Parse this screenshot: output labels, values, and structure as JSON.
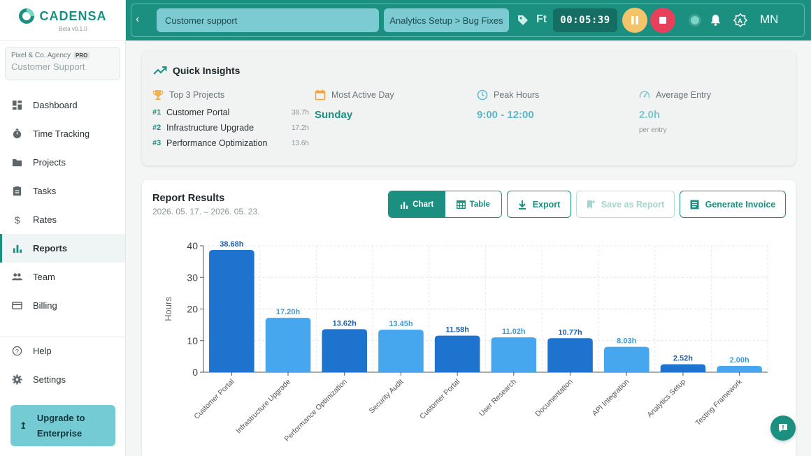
{
  "app": {
    "name": "CADENSA",
    "version": "Beta v0.1.0"
  },
  "org": {
    "name": "Pixel & Co. Agency",
    "plan": "PRO",
    "workspace": "Customer Support"
  },
  "nav": {
    "items": [
      {
        "label": "Dashboard",
        "icon": "dashboard-icon"
      },
      {
        "label": "Time Tracking",
        "icon": "timer-icon"
      },
      {
        "label": "Projects",
        "icon": "folder-icon"
      },
      {
        "label": "Tasks",
        "icon": "clipboard-icon"
      },
      {
        "label": "Rates",
        "icon": "dollar-icon"
      },
      {
        "label": "Reports",
        "icon": "bar-chart-icon",
        "active": true
      },
      {
        "label": "Team",
        "icon": "team-icon"
      },
      {
        "label": "Billing",
        "icon": "card-icon"
      }
    ],
    "bottom": [
      {
        "label": "Help",
        "icon": "help-icon"
      },
      {
        "label": "Settings",
        "icon": "gear-icon"
      }
    ],
    "upgrade_line1": "Upgrade to",
    "upgrade_line2": "Enterprise"
  },
  "topbar": {
    "description_value": "Customer support",
    "project_path": "Analytics Setup > Bug Fixes",
    "tag_abbrev": "Ft",
    "timer": "00:05:39",
    "avatar_initials": "MN"
  },
  "insights": {
    "title": "Quick Insights",
    "top_projects_label": "Top 3 Projects",
    "top_projects": [
      {
        "rank": "#1",
        "name": "Customer Portal",
        "hours": "38.7h"
      },
      {
        "rank": "#2",
        "name": "Infrastructure Upgrade",
        "hours": "17.2h"
      },
      {
        "rank": "#3",
        "name": "Performance Optimization",
        "hours": "13.6h"
      }
    ],
    "most_active_label": "Most Active Day",
    "most_active_value": "Sunday",
    "peak_hours_label": "Peak Hours",
    "peak_hours_value": "9:00 - 12:00",
    "avg_entry_label": "Average Entry",
    "avg_entry_value": "2.0h",
    "avg_entry_note": "per entry"
  },
  "report": {
    "title": "Report Results",
    "date_range": "2026. 05. 17. – 2026. 05. 23.",
    "view_chart": "Chart",
    "view_table": "Table",
    "export": "Export",
    "save_report": "Save as Report",
    "generate_invoice": "Generate Invoice"
  },
  "colors": {
    "primary": "#1b8f80",
    "bar_dark": "#1e73cf",
    "bar_light": "#46a6ee"
  },
  "chart_data": {
    "type": "bar",
    "ylabel": "Hours",
    "ylim": [
      0,
      40
    ],
    "yticks": [
      0,
      10,
      20,
      30,
      40
    ],
    "grid": true,
    "categories": [
      "Customer Portal",
      "Infrastructure Upgrade",
      "Performance Optimization",
      "Security Audit",
      "Customer Portal",
      "User Research",
      "Documentation",
      "API Integration",
      "Analytics Setup",
      "Testing Framework"
    ],
    "values": [
      38.68,
      17.2,
      13.62,
      13.45,
      11.58,
      11.02,
      10.77,
      8.03,
      2.52,
      2.0
    ],
    "labels": [
      "38.68h",
      "17.20h",
      "13.62h",
      "13.45h",
      "11.58h",
      "11.02h",
      "10.77h",
      "8.03h",
      "2.52h",
      "2.00h"
    ]
  }
}
